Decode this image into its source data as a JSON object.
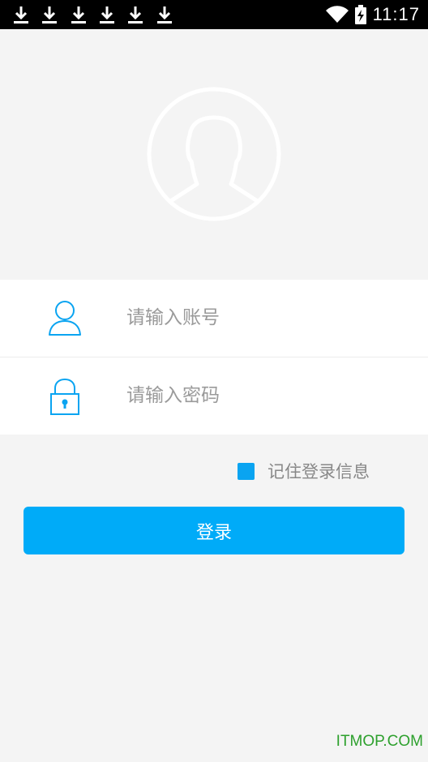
{
  "status_bar": {
    "time": "11:17",
    "download_count": 6,
    "icons": [
      "download-icon",
      "wifi-icon",
      "battery-charging-icon"
    ]
  },
  "avatar": {
    "icon": "user-avatar-icon"
  },
  "form": {
    "account_placeholder": "请输入账号",
    "account_value": "",
    "password_placeholder": "请输入密码",
    "password_value": "",
    "remember_label": "记住登录信息",
    "login_label": "登录"
  },
  "colors": {
    "accent": "#00abf8",
    "background": "#f4f4f4"
  },
  "watermark": "ITMOP.COM"
}
